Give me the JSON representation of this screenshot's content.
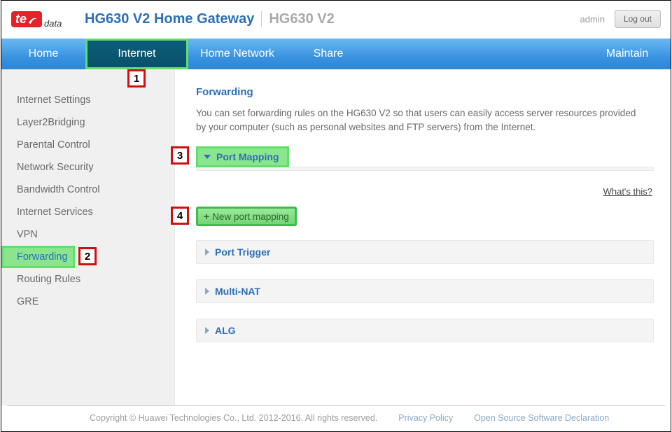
{
  "logo": {
    "badge": "te",
    "word": "data"
  },
  "header": {
    "title": "HG630 V2 Home Gateway",
    "model": "HG630 V2",
    "user": "admin",
    "logout": "Log out"
  },
  "nav": {
    "home": "Home",
    "internet": "Internet",
    "home_network": "Home Network",
    "share": "Share",
    "maintain": "Maintain"
  },
  "callouts": {
    "c1": "1",
    "c2": "2",
    "c3": "3",
    "c4": "4"
  },
  "sidebar": {
    "items": [
      {
        "label": "Internet Settings"
      },
      {
        "label": "Layer2Bridging"
      },
      {
        "label": "Parental Control"
      },
      {
        "label": "Network Security"
      },
      {
        "label": "Bandwidth Control"
      },
      {
        "label": "Internet Services"
      },
      {
        "label": "VPN"
      },
      {
        "label": "Forwarding"
      },
      {
        "label": "Routing Rules"
      },
      {
        "label": "GRE"
      }
    ]
  },
  "content": {
    "title": "Forwarding",
    "desc": "You can set forwarding rules on the HG630 V2 so that users can easily access server resources provided by your computer (such as personal websites and FTP servers) from the Internet.",
    "whats_this": "What's this?",
    "new_port": "New port mapping",
    "acc": {
      "port_mapping": "Port Mapping",
      "port_trigger": "Port Trigger",
      "multi_nat": "Multi-NAT",
      "alg": "ALG"
    }
  },
  "footer": {
    "copyright": "Copyright © Huawei Technologies Co., Ltd. 2012-2016. All rights reserved.",
    "privacy": "Privacy Policy",
    "oss": "Open Source Software Declaration"
  }
}
